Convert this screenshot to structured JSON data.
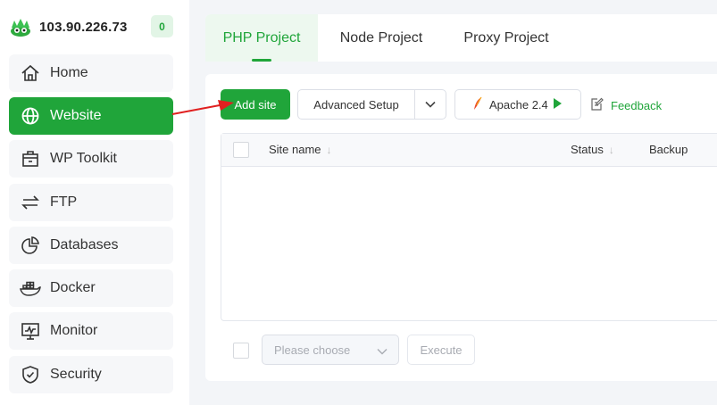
{
  "server": {
    "ip": "103.90.226.73",
    "badge_count": "0"
  },
  "sidebar": {
    "items": [
      {
        "label": "Home",
        "icon": "home-icon"
      },
      {
        "label": "Website",
        "icon": "globe-icon",
        "active": true
      },
      {
        "label": "WP Toolkit",
        "icon": "toolkit-icon"
      },
      {
        "label": "FTP",
        "icon": "transfer-arrows-icon"
      },
      {
        "label": "Databases",
        "icon": "pie-chart-icon"
      },
      {
        "label": "Docker",
        "icon": "docker-whale-icon"
      },
      {
        "label": "Monitor",
        "icon": "monitor-icon"
      },
      {
        "label": "Security",
        "icon": "shield-icon"
      }
    ]
  },
  "tabs": [
    {
      "label": "PHP Project",
      "active": true
    },
    {
      "label": "Node Project"
    },
    {
      "label": "Proxy Project"
    }
  ],
  "toolbar": {
    "add_site": "Add site",
    "advanced_setup": "Advanced Setup",
    "apache": "Apache 2.4",
    "feedback": "Feedback"
  },
  "table": {
    "columns": [
      {
        "label": "Site name",
        "sortable": true
      },
      {
        "label": "Status",
        "sortable": true
      },
      {
        "label": "Backup",
        "sortable": false
      }
    ],
    "rows": []
  },
  "footer": {
    "select_placeholder": "Please choose",
    "execute": "Execute"
  },
  "colors": {
    "accent": "#20a53a",
    "annotation_arrow": "#e02020"
  }
}
